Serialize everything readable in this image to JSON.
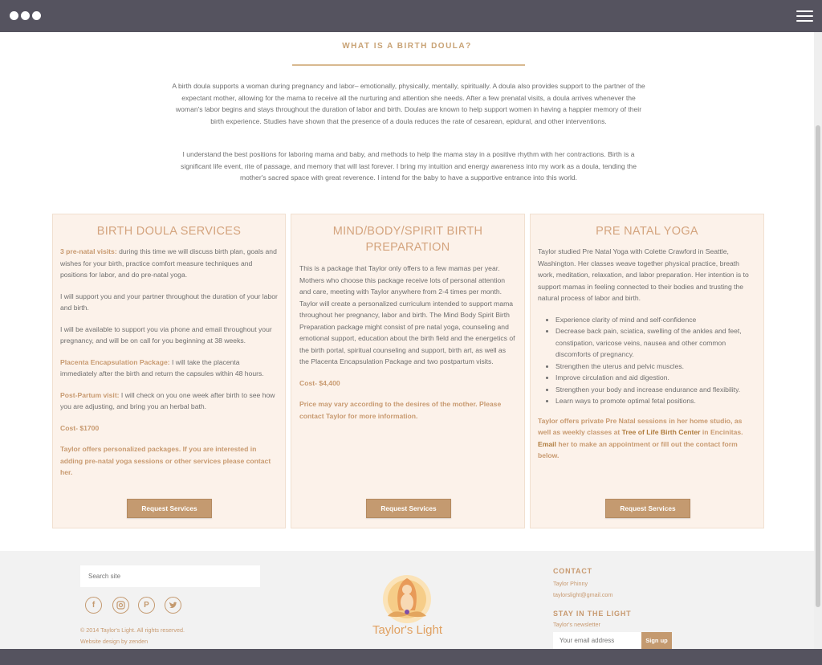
{
  "intro": {
    "title": "WHAT IS A BIRTH DOULA?",
    "paragraph1": "A birth doula supports a woman during pregnancy and labor– emotionally, physically, mentally, spiritually. A doula also provides support to the partner of the expectant mother, allowing for the mama to receive all the nurturing and attention she needs. After a few prenatal visits, a doula arrives whenever the woman's labor begins and stays throughout the duration of labor and birth. Doulas are known to help support women in having a happier memory of their birth experience. Studies have shown that the presence of a doula reduces the rate of cesarean, epidural, and other interventions.",
    "paragraph2": "I understand the best positions for laboring mama and baby, and methods to help the mama stay in a positive rhythm with her contractions. Birth is a significant life event, rite of passage, and memory that will last forever. I bring my intuition and energy awareness into my work as a doula, tending the mother's sacred space with great reverence. I intend for the baby to have a supportive entrance into this world."
  },
  "cards": {
    "doula": {
      "title": "BIRTH DOULA SERVICES",
      "p1_label": "3 pre-natal visits:",
      "p1_text": " during this time we will discuss birth plan, goals and wishes for your birth, practice comfort measure techniques and positions for labor, and do pre-natal yoga.",
      "p2": "I will support you and your partner throughout the duration of your labor and birth.",
      "p3": "I will be available to support you via phone and email throughout your pregnancy, and will be on call for you beginning at 38 weeks.",
      "p4_label": "Placenta Encapsulation Package:",
      "p4_text": " I will take the placenta immediately after the birth and return the capsules within 48 hours.",
      "p5_label": "Post-Partum visit:",
      "p5_text": " I will check on you one week after birth to see how you are adjusting, and bring you an herbal bath.",
      "cost": "Cost- $1700",
      "note": "Taylor offers personalized packages. If you are interested in adding pre-natal yoga sessions or other services please contact her.",
      "button": "Request Services"
    },
    "mbs": {
      "title": "MIND/BODY/SPIRIT BIRTH PREPARATION",
      "p1": "This is a package that Taylor only offers to a few mamas per year. Mothers who choose this package receive lots of personal attention and care, meeting with Taylor anywhere from 2-4 times per month. Taylor will create a personalized curriculum intended to support mama throughout her pregnancy, labor and birth. The Mind Body Spirit Birth Preparation package might consist of pre natal yoga, counseling and emotional support, education about the birth field and the energetics of the birth portal, spiritual counseling and support, birth art, as well as the Placenta Encapsulation Package and two postpartum visits.",
      "cost": "Cost- $4,400",
      "note": "Price may vary according to the desires of the mother. Please contact Taylor for more information.",
      "button": "Request Services"
    },
    "yoga": {
      "title": "PRE NATAL YOGA",
      "p1": "Taylor studied Pre Natal Yoga with Colette Crawford in Seattle, Washington. Her classes weave together physical practice, breath work, meditation, relaxation,  and labor preparation. Her intention is to support mamas in feeling connected to their bodies and trusting the natural process of labor and birth.",
      "benefits": [
        "Experience clarity of mind and self-confidence",
        "Decrease back pain, sciatica, swelling of the ankles and feet, constipation, varicose veins, nausea and other common discomforts of pregnancy.",
        "Strengthen the uterus and pelvic muscles.",
        "Improve circulation and aid digestion.",
        "Strengthen your body and increase endurance and flexibility.",
        "Learn ways to promote optimal fetal positions."
      ],
      "note_a": "Taylor offers private Pre Natal sessions in her home studio, as well as weekly classes at ",
      "note_link": "Tree of Life Birth Center",
      "note_b": " in Encinitas. ",
      "note_email": "Email",
      "note_c": " her to make an appointment or fill out the contact form below.",
      "button": "Request Services"
    }
  },
  "footer": {
    "search_placeholder": "Search site",
    "social_icons": [
      "facebook-icon",
      "instagram-icon",
      "pinterest-icon",
      "twitter-icon"
    ],
    "copyright": "© 2014 Taylor's Light. All rights reserved.",
    "credit": "Website design by zenden",
    "brand": "Taylor's Light",
    "contact_heading": "CONTACT",
    "contact_name": "Taylor Phinny",
    "contact_email": "taylorslight@gmail.com",
    "newsletter_heading": "STAY IN THE LIGHT",
    "newsletter_sub": "Taylor's newsletter",
    "email_placeholder": "Your email address",
    "signup": "Sign up"
  },
  "colors": {
    "topbar": "#55535f",
    "accent": "#c49a70",
    "card_bg": "#fcf2ea",
    "heading": "#d4a47e"
  }
}
